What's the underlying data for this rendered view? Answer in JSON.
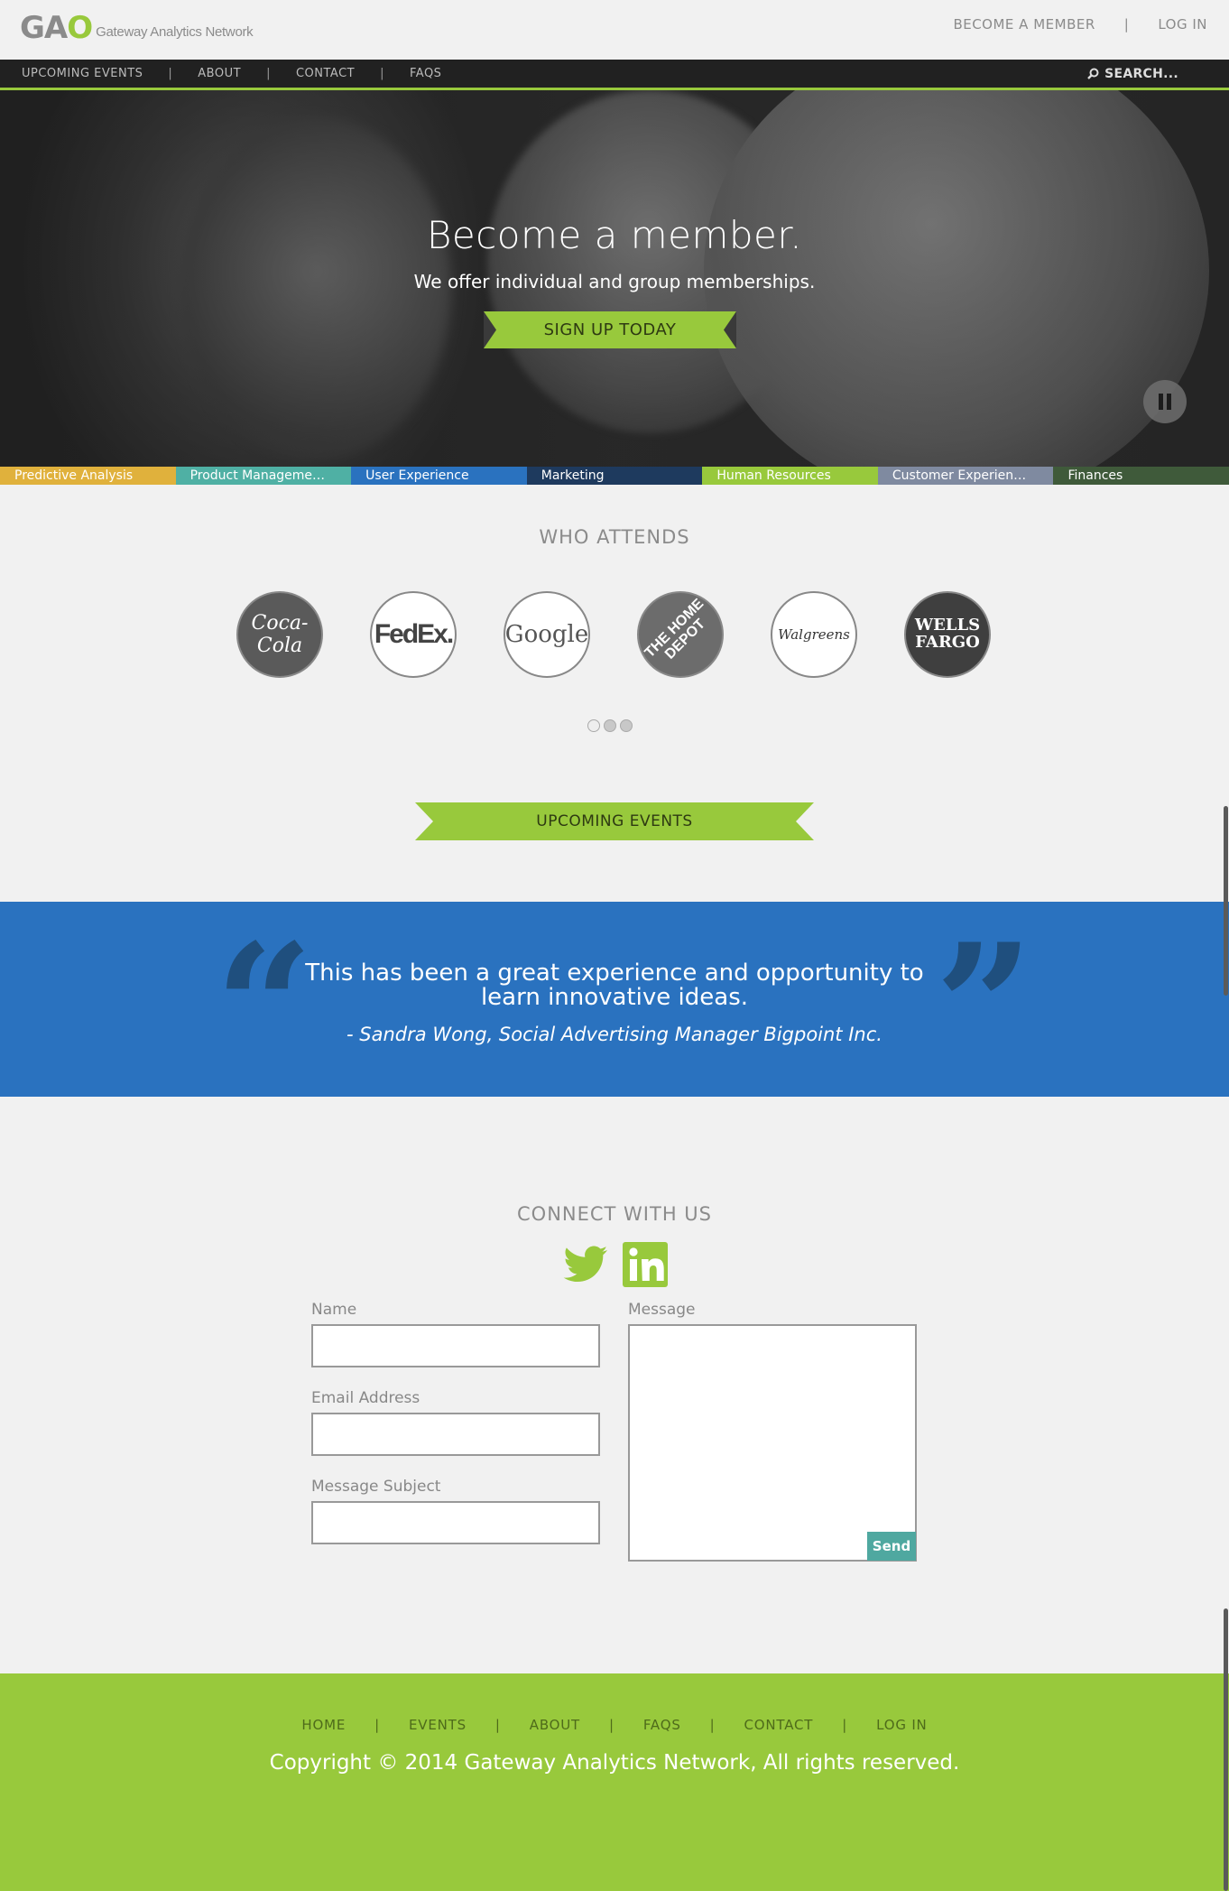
{
  "header": {
    "brand_mark": "GAO",
    "brand_name": "Gateway Analytics Network",
    "links": [
      "BECOME A MEMBER",
      "LOG IN"
    ],
    "separator": "|"
  },
  "nav": {
    "items": [
      "UPCOMING EVENTS",
      "ABOUT",
      "CONTACT",
      "FAQS"
    ],
    "separator": "|",
    "search_label": "SEARCH..."
  },
  "hero": {
    "title": "Become a member.",
    "subtitle": "We offer individual and group memberships.",
    "cta": "SIGN UP TODAY",
    "pause_icon": "pause-icon"
  },
  "categories": [
    {
      "label": "Predictive Analysis",
      "color": "#e0b13c"
    },
    {
      "label": "Product Manageme…",
      "color": "#4fb0a4"
    },
    {
      "label": "User Experience",
      "color": "#2a72bf"
    },
    {
      "label": "Marketing",
      "color": "#1e3a5e"
    },
    {
      "label": "Human Resources",
      "color": "#98c93c"
    },
    {
      "label": "Customer Experien…",
      "color": "#7f8aa0"
    },
    {
      "label": "Finances",
      "color": "#3f5a3a"
    }
  ],
  "who_attends": {
    "title": "WHO ATTENDS",
    "logos": [
      {
        "name": "coca-cola-logo",
        "text": "Coca-Cola"
      },
      {
        "name": "fedex-logo",
        "text": "FedEx."
      },
      {
        "name": "google-logo",
        "text": "Google"
      },
      {
        "name": "home-depot-logo",
        "text": "THE HOME DEPOT"
      },
      {
        "name": "walgreens-logo",
        "text": "Walgreens"
      },
      {
        "name": "wells-fargo-logo",
        "text": "WELLS FARGO"
      }
    ],
    "pager_count": 3,
    "pager_active": 0
  },
  "events_button": "UPCOMING EVENTS",
  "testimonial": {
    "quote": "This has been a great experience and opportunity to learn innovative ideas.",
    "author": "- Sandra Wong, Social Advertising Manager Bigpoint Inc.",
    "open_mark": "“",
    "close_mark": "”"
  },
  "connect": {
    "title": "CONNECT WITH US",
    "social": [
      "twitter-icon",
      "linkedin-icon"
    ],
    "name_label": "Name",
    "email_label": "Email Address",
    "subject_label": "Message Subject",
    "message_label": "Message",
    "send_label": "Send",
    "name_value": "",
    "email_value": "",
    "subject_value": "",
    "message_value": ""
  },
  "footer": {
    "links": [
      "HOME",
      "EVENTS",
      "ABOUT",
      "FAQS",
      "CONTACT",
      "LOG IN"
    ],
    "separator": "|",
    "copyright": "Copyright © 2014 Gateway Analytics Network, All rights reserved."
  },
  "colors": {
    "accent_green": "#98c93c",
    "testimonial_blue": "#2a72bf",
    "nav_dark": "#212121",
    "send_teal": "#4fa8a0"
  }
}
